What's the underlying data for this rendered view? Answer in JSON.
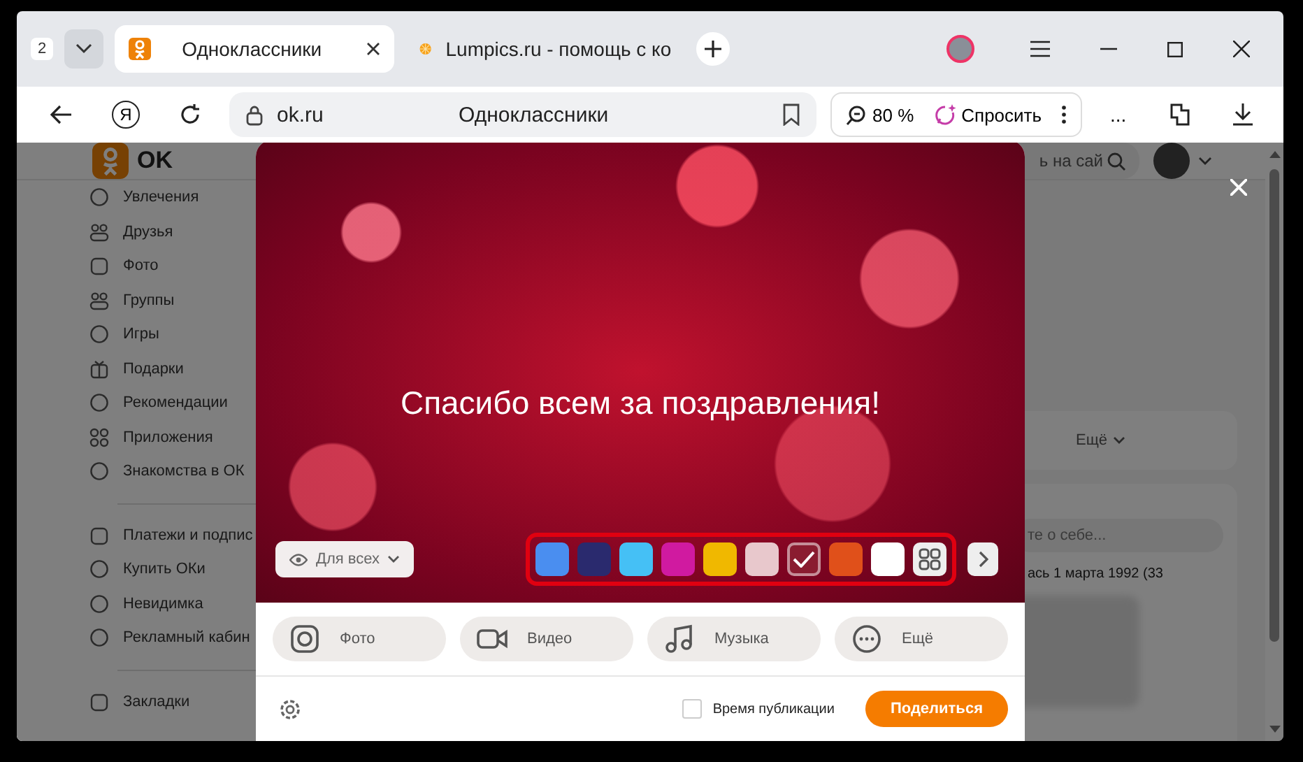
{
  "browser": {
    "tab_count": "2",
    "tabs": [
      {
        "title": "Одноклассники",
        "kind": "ok",
        "selected": true
      },
      {
        "title": "Lumpics.ru - помощь с ко",
        "kind": "lumpics",
        "selected": false
      }
    ],
    "yandex_button": "Я",
    "address": {
      "domain": "ok.ru",
      "title": "Одноклассники"
    },
    "zoom": "80 %",
    "ask_button": "Спросить",
    "more": "..."
  },
  "page": {
    "logo": "OK",
    "search_text": "ь на сай",
    "sidebar": [
      {
        "label": "Увлечения"
      },
      {
        "label": "Друзья"
      },
      {
        "label": "Фото"
      },
      {
        "label": "Группы"
      },
      {
        "label": "Игры"
      },
      {
        "label": "Подарки"
      },
      {
        "label": "Рекомендации"
      },
      {
        "label": "Приложения"
      },
      {
        "label": "Знакомства в ОК"
      }
    ],
    "sidebar_2": [
      {
        "label": "Платежи и подпис"
      },
      {
        "label": "Купить ОКи"
      },
      {
        "label": "Невидимка"
      },
      {
        "label": "Рекламный кабин"
      }
    ],
    "sidebar_3": [
      {
        "label": "Закладки"
      }
    ],
    "more_link": "Ещё",
    "about_placeholder": "те о себе...",
    "birthday": "ась 1 марта 1992 (33"
  },
  "modal": {
    "post_text": "Спасибо всем за поздравления!",
    "audience": "Для всех",
    "backgrounds": [
      {
        "color": "#4a8ef0",
        "selected": false
      },
      {
        "color": "#2a2a6e",
        "selected": false
      },
      {
        "color": "#45c0f5",
        "selected": false
      },
      {
        "color": "#d01aa0",
        "selected": false
      },
      {
        "color": "#f0b800",
        "selected": false
      },
      {
        "color": "#e8c8cc",
        "selected": false
      },
      {
        "color": "#8a1c30",
        "selected": true
      },
      {
        "color": "#e0501a",
        "selected": false
      },
      {
        "color": "#ffffff",
        "selected": false
      }
    ],
    "actions": [
      {
        "label": "Фото"
      },
      {
        "label": "Видео"
      },
      {
        "label": "Музыка"
      },
      {
        "label": "Ещё"
      }
    ],
    "schedule": {
      "label": "Время публикации",
      "checked": false
    },
    "share_button": "Поделиться"
  }
}
